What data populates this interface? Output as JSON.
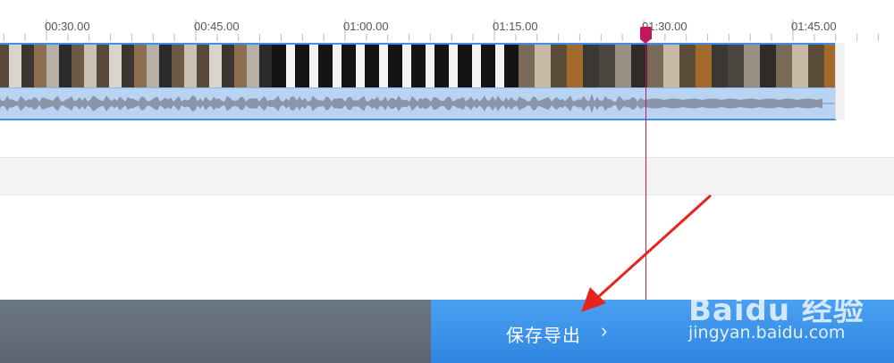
{
  "ruler": {
    "ticks": [
      {
        "label": "00:30.00"
      },
      {
        "label": "00:45.00"
      },
      {
        "label": "01:00.00"
      },
      {
        "label": "01:15.00"
      },
      {
        "label": "01:30.00"
      },
      {
        "label": "01:45.00"
      }
    ]
  },
  "colors": {
    "accent": "#3f8fe8",
    "playhead": "#c2185b",
    "export_button": "#3a93ea",
    "bottom_bar": "#636e79",
    "audio_track_bg": "#b9d3f2",
    "waveform": "#8a96a8",
    "annotation_arrow": "#e8231e"
  },
  "export": {
    "label": "保存导出",
    "chevron": "›"
  },
  "watermark": {
    "brand": "Baidu 经验",
    "url": "jingyan.baidu.com"
  }
}
